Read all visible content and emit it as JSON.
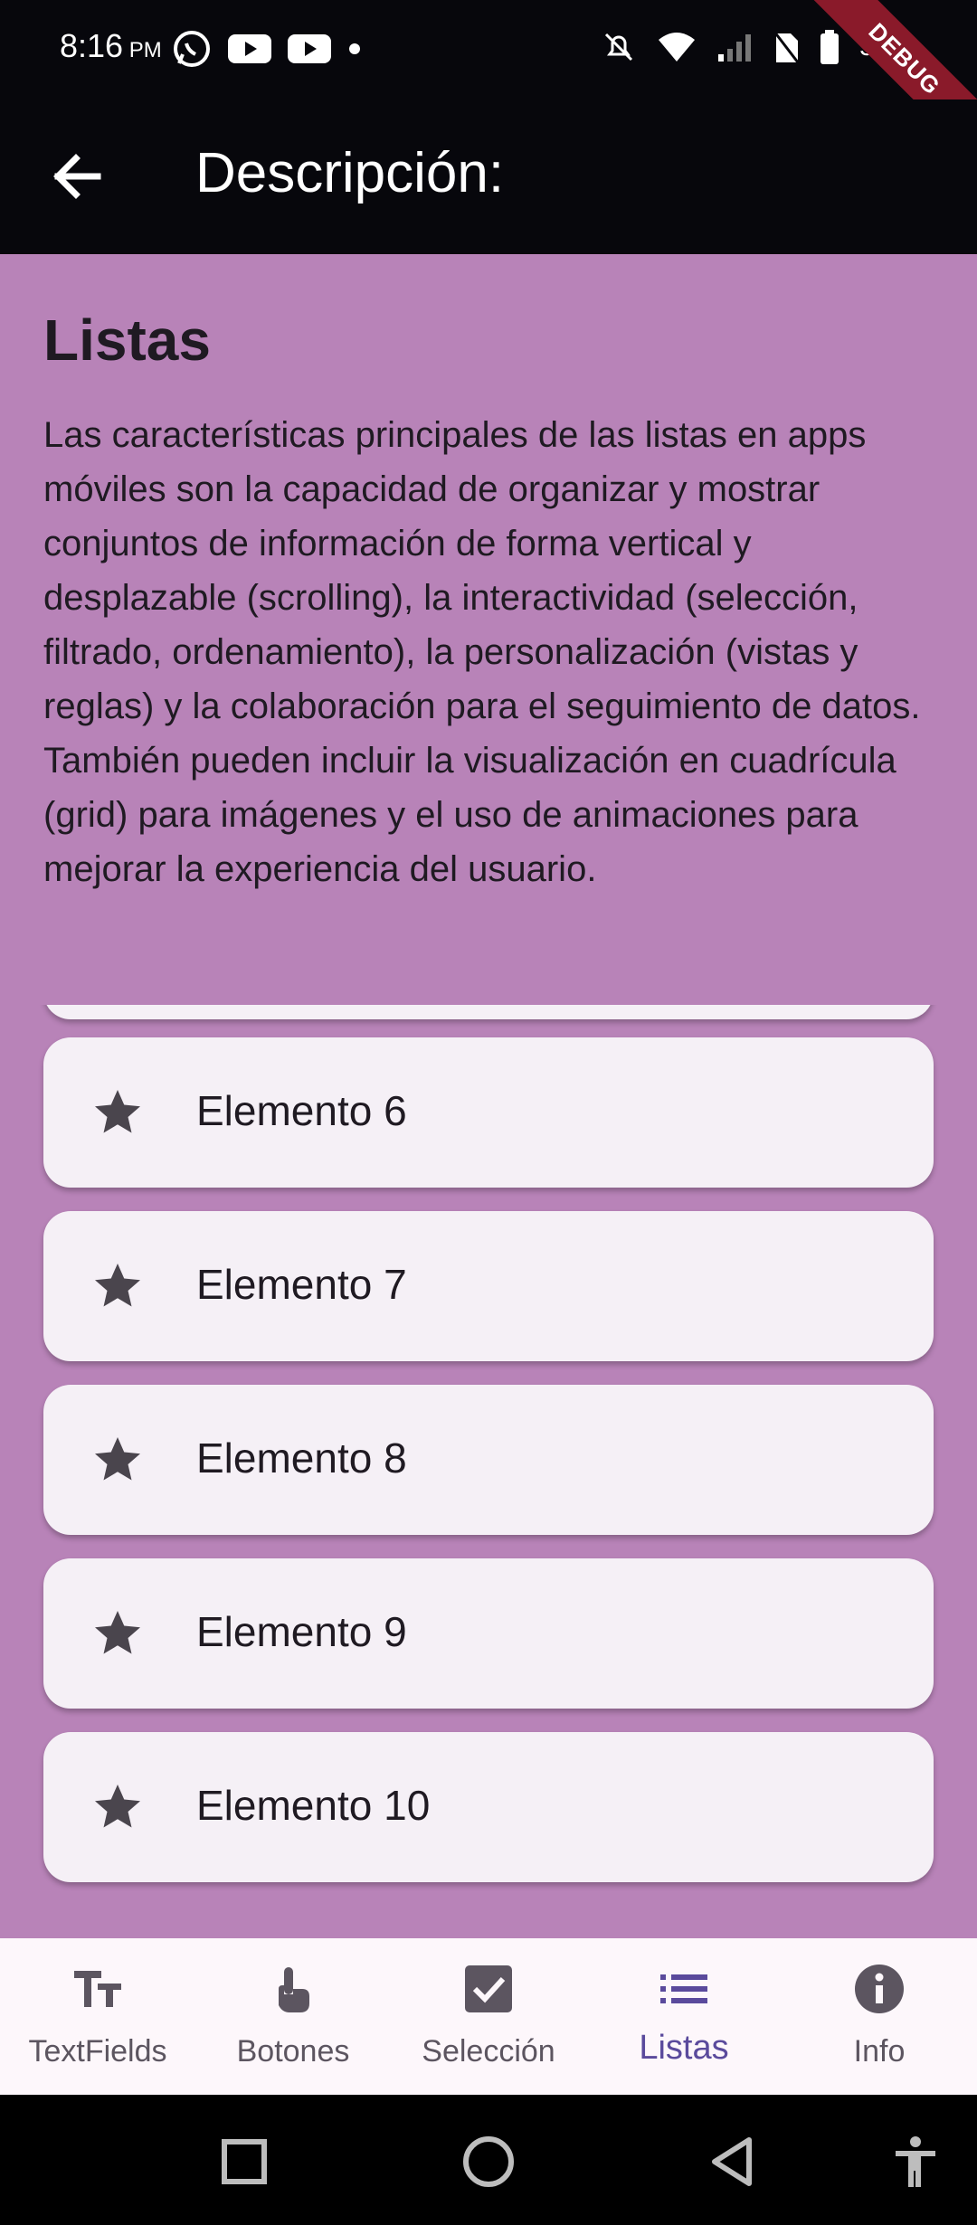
{
  "status_bar": {
    "time": "8:16",
    "ampm": "PM",
    "battery": "58%",
    "debug_label": "DEBUG"
  },
  "app_bar": {
    "title": "Descripción:",
    "back_icon": "arrow-back-icon"
  },
  "section": {
    "title": "Listas",
    "description": "Las características principales de las listas en apps móviles son la capacidad de organizar y mostrar conjuntos de información de forma vertical y desplazable (scrolling), la interactividad (selección, filtrado, ordenamiento), la personalización (vistas y reglas) y la colaboración para el seguimiento de datos. También pueden incluir la visualización en cuadrícula (grid) para imágenes y el uso de animaciones para mejorar la experiencia del usuario."
  },
  "list": {
    "icon": "star-icon",
    "items": [
      {
        "label": "Elemento 6"
      },
      {
        "label": "Elemento 7"
      },
      {
        "label": "Elemento 8"
      },
      {
        "label": "Elemento 9"
      },
      {
        "label": "Elemento 10"
      }
    ]
  },
  "bottom_nav": {
    "items": [
      {
        "label": "TextFields",
        "icon": "text-fields-icon"
      },
      {
        "label": "Botones",
        "icon": "touch-icon"
      },
      {
        "label": "Selección",
        "icon": "checkbox-icon"
      },
      {
        "label": "Listas",
        "icon": "list-icon",
        "active": true
      },
      {
        "label": "Info",
        "icon": "info-icon"
      }
    ]
  },
  "colors": {
    "background": "#b883b8",
    "app_bar": "#07070c",
    "card": "#f5f0f6",
    "nav_active": "#5a4a9c",
    "nav_inactive": "#5c5560"
  }
}
